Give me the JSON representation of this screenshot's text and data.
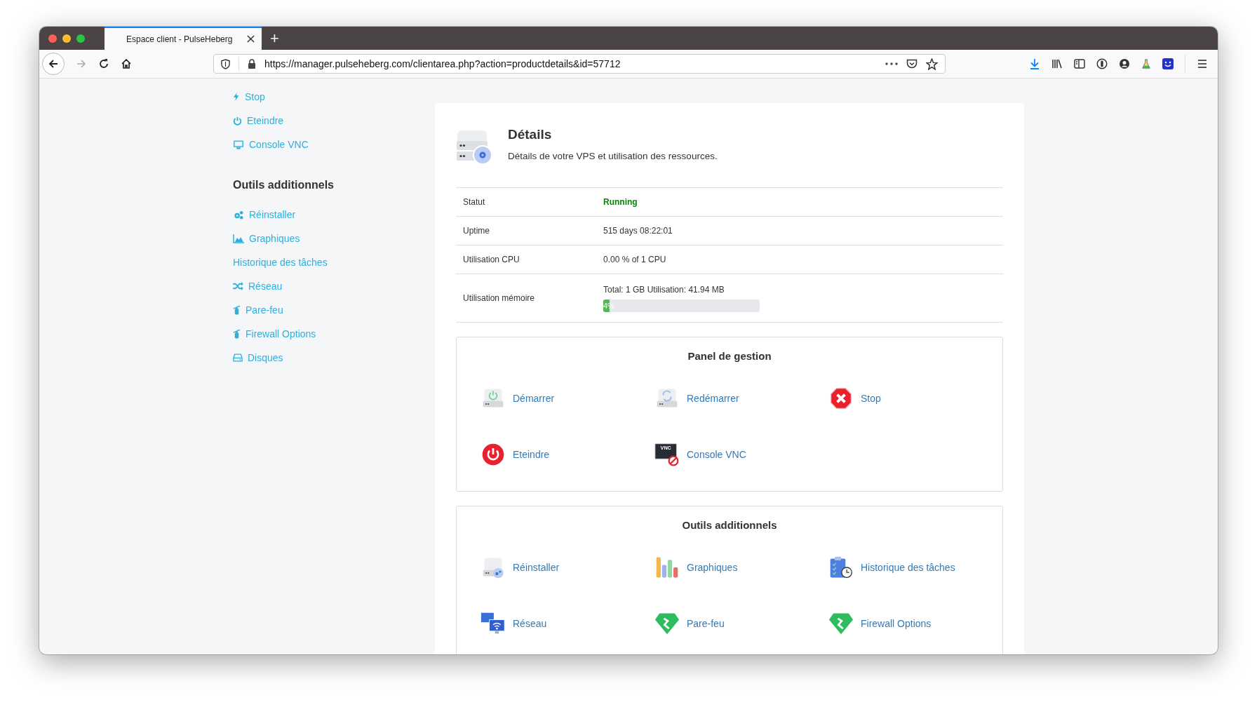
{
  "browser": {
    "tab_title": "Espace client - PulseHeberg",
    "new_tab": "+",
    "url": "https://manager.pulseheberg.com/clientarea.php?action=productdetails&id=57712"
  },
  "sidebar": {
    "actions": [
      "Stop",
      "Eteindre",
      "Console VNC"
    ],
    "section_title": "Outils additionnels",
    "tools": [
      "Réinstaller",
      "Graphiques",
      "Historique des tâches",
      "Réseau",
      "Pare-feu",
      "Firewall Options",
      "Disques"
    ]
  },
  "details": {
    "title": "Détails",
    "subtitle": "Détails de votre VPS et utilisation des ressources.",
    "rows": [
      {
        "kind": "status",
        "label": "Statut",
        "value": "Running"
      },
      {
        "kind": "text",
        "label": "Uptime",
        "value": "515 days 08:22:01"
      },
      {
        "kind": "text",
        "label": "Utilisation CPU",
        "value": "0.00 % of 1 CPU"
      },
      {
        "kind": "meter",
        "label": "Utilisation mémoire",
        "value": "Total: 1 GB Utilisation: 41.94 MB",
        "level": 0.04,
        "reading": "4%"
      }
    ]
  },
  "panel": {
    "title": "Panel de gestion",
    "actions": [
      {
        "label": "Démarrer"
      },
      {
        "label": "Redémarrer"
      },
      {
        "label": "Stop"
      },
      {
        "label": "Eteindre"
      },
      {
        "label": "Console VNC",
        "icon_text": "VNC"
      }
    ]
  },
  "tools": {
    "title": "Outils additionnels",
    "items": [
      "Réinstaller",
      "Graphiques",
      "Historique des tâches",
      "Réseau",
      "Pare-feu",
      "Firewall Options"
    ]
  }
}
